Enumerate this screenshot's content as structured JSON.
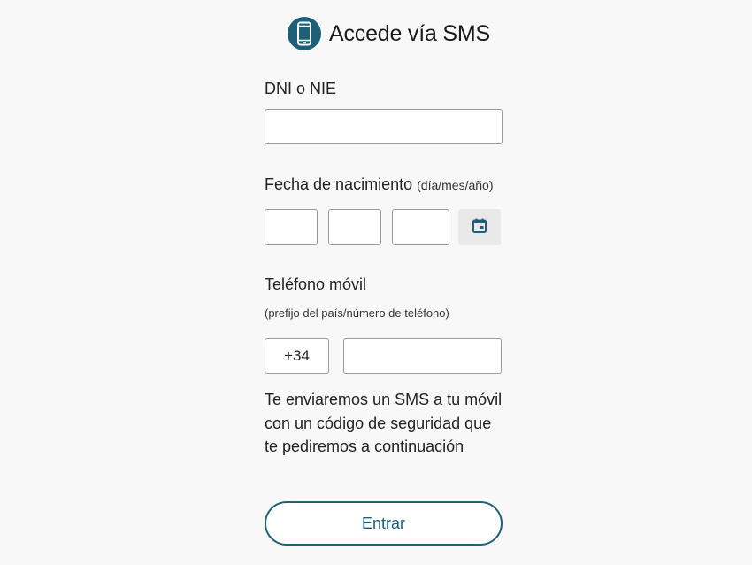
{
  "header": {
    "title": "Accede vía SMS",
    "icon": "mobile-phone-icon"
  },
  "dni": {
    "label": "DNI o NIE",
    "value": "",
    "placeholder": ""
  },
  "birthdate": {
    "label": "Fecha de nacimiento",
    "hint": "(día/mes/año)",
    "day_value": "",
    "month_value": "",
    "year_value": "",
    "calendar_icon": "calendar-icon"
  },
  "phone": {
    "label": "Teléfono móvil",
    "sub_label": "(prefijo del país/número de teléfono)",
    "prefix": "+34",
    "number_value": ""
  },
  "info": {
    "line1": "Te enviaremos un SMS a tu móvil",
    "line2": "con un código de seguridad que",
    "line3": "te pediremos a continuación"
  },
  "submit": {
    "label": "Entrar"
  },
  "colors": {
    "accent": "#1e6078",
    "background": "#f8f8f8"
  }
}
